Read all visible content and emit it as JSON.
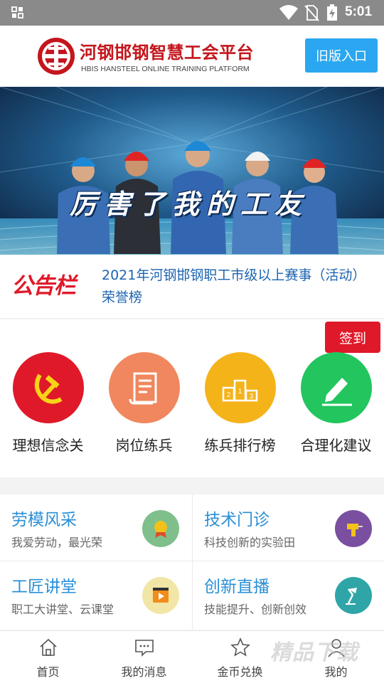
{
  "status_bar": {
    "time": "5:01"
  },
  "header": {
    "title": "河钢邯钢智慧工会平台",
    "subtitle": "HBIS HANSTEEL ONLINE TRAINING PLATFORM",
    "old_version_button": "旧版入口",
    "brand_color": "#c4161c"
  },
  "banner": {
    "slogan": "厉害了我的工友",
    "dots_total": 7,
    "active_dot": 1
  },
  "notice": {
    "tag": "公告栏",
    "text": "2021年河钢邯钢职工市级以上赛事（活动）荣誉榜"
  },
  "checkin_button": "签到",
  "feature_icons": [
    {
      "label": "理想信念关",
      "icon": "party-emblem-icon",
      "color": "#e0192a"
    },
    {
      "label": "岗位练兵",
      "icon": "scroll-icon",
      "color": "#f0875e"
    },
    {
      "label": "练兵排行榜",
      "icon": "podium-icon",
      "color": "#f5b31a"
    },
    {
      "label": "合理化建议",
      "icon": "pen-icon",
      "color": "#22c55e"
    }
  ],
  "cards": [
    {
      "title": "劳模风采",
      "subtitle": "我爱劳动，最光荣",
      "icon": "medal-icon",
      "color": "#7fbf8c"
    },
    {
      "title": "技术门诊",
      "subtitle": "科技创新的实验田",
      "icon": "drill-icon",
      "color": "#7a4fa0"
    },
    {
      "title": "工匠讲堂",
      "subtitle": "职工大讲堂、云课堂",
      "icon": "video-icon",
      "color": "#f1e6a6"
    },
    {
      "title": "创新直播",
      "subtitle": "技能提升、创新创效",
      "icon": "desk-lamp-icon",
      "color": "#2fa5a8"
    }
  ],
  "tabbar": [
    {
      "label": "首页",
      "icon": "home-icon"
    },
    {
      "label": "我的消息",
      "icon": "message-icon"
    },
    {
      "label": "金币兑换",
      "icon": "star-icon"
    },
    {
      "label": "我的",
      "icon": "user-icon"
    }
  ],
  "watermark": "精品下载"
}
